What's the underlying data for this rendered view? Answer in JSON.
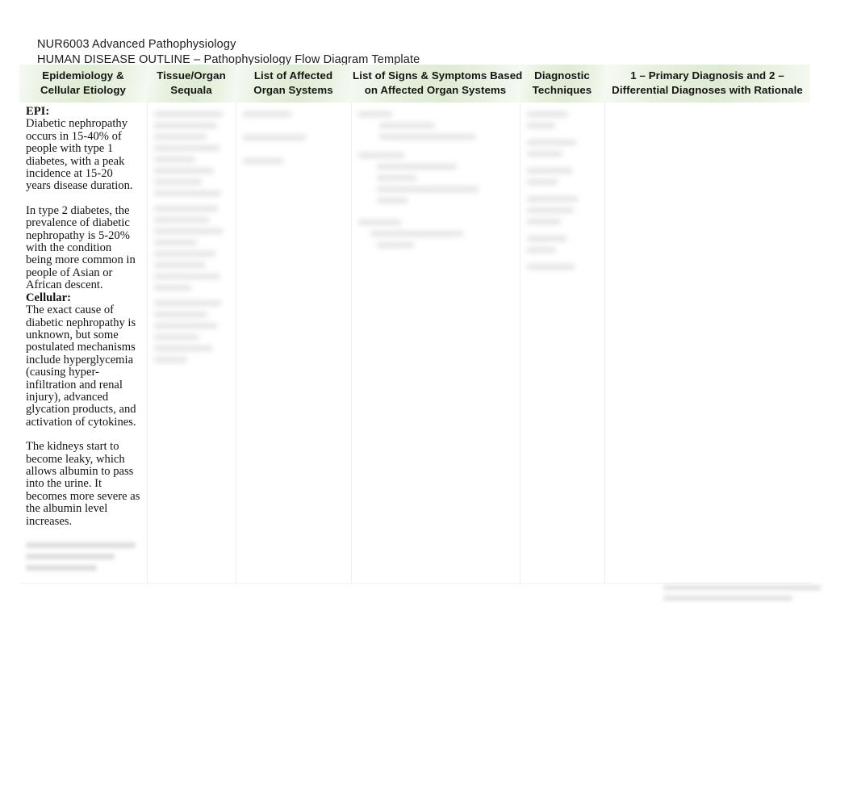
{
  "document": {
    "course_line": "NUR6003 Advanced Pathophysiology",
    "outline_line": "HUMAN DISEASE OUTLINE – Pathophysiology Flow Diagram Template"
  },
  "table": {
    "headers": [
      {
        "line1": "Epidemiology &",
        "line2": "Cellular Etiology"
      },
      {
        "line1": "Tissue/Organ",
        "line2": "Sequala"
      },
      {
        "line1": "List of Affected",
        "line2": "Organ Systems"
      },
      {
        "line1": "List of Signs & Symptoms Based",
        "line2": "on Affected Organ Systems"
      },
      {
        "line1": "Diagnostic",
        "line2": "Techniques"
      },
      {
        "line1": "1 – Primary Diagnosis and 2 –",
        "line2": "Differential Diagnoses with Rationale"
      }
    ],
    "header_bg_start": "#f7faf4",
    "header_bg_mid": "#dfebd4",
    "header_bg_end": "#f6faf3",
    "border_color": "#eceff0",
    "column_1": {
      "epi_label": "EPI:",
      "epi_paragraph_1": "Diabetic nephropathy occurs in 15-40% of people with type 1 diabetes, with a peak incidence at 15-20 years disease duration.",
      "epi_paragraph_2": "In type 2 diabetes, the prevalence of diabetic nephropathy is 5-20% with the condition being more common in people of Asian or African descent.",
      "cellular_label": "Cellular:",
      "cellular_paragraph_1": "The exact cause of diabetic nephropathy is unknown, but some postulated mechanisms include hyperglycemia (causing hyper-infiltration and renal injury), advanced glycation products, and activation of cytokines.",
      "cellular_paragraph_2": "The kidneys start to become leaky, which allows albumin to pass into the urine. It becomes more severe as the albumin level increases."
    },
    "column_2": {
      "content_state": "blurred-illegible"
    },
    "column_3": {
      "content_state": "blurred-illegible"
    },
    "column_4": {
      "content_state": "blurred-illegible"
    },
    "column_5": {
      "content_state": "blurred-illegible"
    },
    "column_6": {
      "content_state": "empty"
    }
  },
  "footer": {
    "note_state": "blurred-illegible"
  }
}
